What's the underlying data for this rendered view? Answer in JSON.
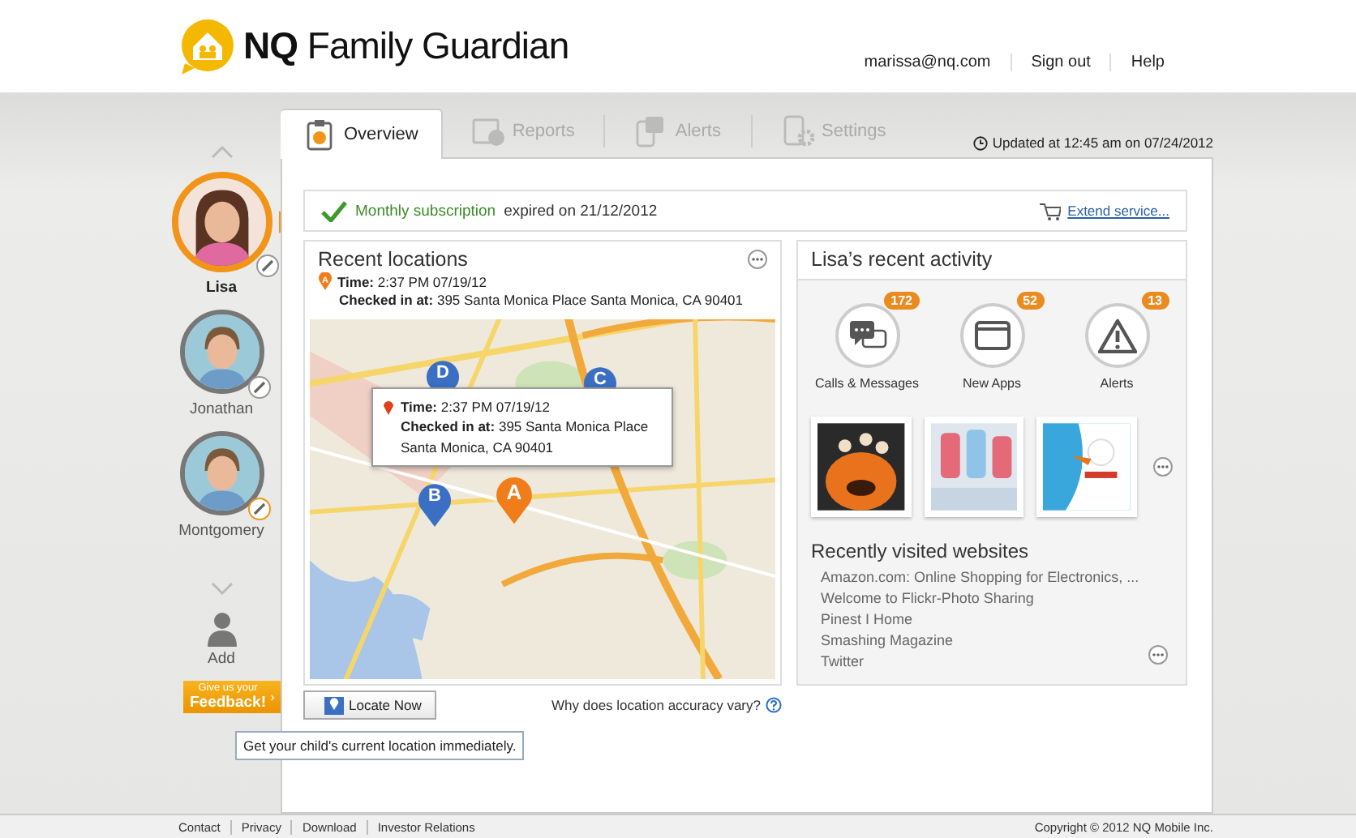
{
  "header": {
    "logo": "**NQ** Family Guardian",
    "user_links": [
      {
        "label": "marissa@nq.com"
      },
      {
        "label": "Sign out"
      },
      {
        "label": "Help"
      }
    ]
  },
  "children": [
    {
      "name": "Lisa",
      "selected": true,
      "kind": "girl"
    },
    {
      "name": "Jonathan",
      "selected": false,
      "kind": "boy"
    },
    {
      "name": "Montgomery",
      "selected": false,
      "kind": "boy"
    }
  ],
  "add_label": "Add",
  "feedback": {
    "line1": "Give us your",
    "line2": "Feedback!"
  },
  "tabs": [
    {
      "label": "Overview",
      "selected": true,
      "kind": "overview"
    },
    {
      "label": "Reports",
      "selected": false,
      "kind": "reports"
    },
    {
      "label": "Alerts",
      "selected": false,
      "kind": "alerts"
    },
    {
      "label": "Settings",
      "selected": false,
      "kind": "settings"
    }
  ],
  "updated": "Updated at 12:45 am on 07/24/2012",
  "subscription": {
    "plan": "Monthly subscription",
    "status": "expired on 21/12/2012",
    "link": "Extend service..."
  },
  "recent_locations": {
    "title": "Recent locations",
    "marker": "A",
    "time": "**Time:** 2:37 PM 07/19/12",
    "checked_in": "**Checked in at:** 395 Santa Monica Place Santa Monica, CA 90401",
    "popup": {
      "time": "**Time:** 2:37 PM 07/19/12",
      "checked_in": "**Checked in at:** 395 Santa Monica Place",
      "address": "Santa Monica, CA 90401"
    },
    "pins": [
      {
        "label": "D",
        "color": "#3a6fc4",
        "kind": "past"
      },
      {
        "label": "C",
        "color": "#3a6fc4",
        "kind": "past"
      },
      {
        "label": "B",
        "color": "#3a6fc4",
        "kind": "past"
      },
      {
        "label": "A",
        "color": "#f07c1a",
        "kind": "current"
      }
    ]
  },
  "locate_button": "Locate Now",
  "tooltip": "Get your child's current location immediately.",
  "accuracy_link": "Why does location accuracy vary?",
  "activity": {
    "title": "Lisa’s recent activity",
    "stats": [
      {
        "label": "Calls & Messages",
        "count": "172",
        "kind": "messages"
      },
      {
        "label": "New Apps",
        "count": "52",
        "kind": "apps"
      },
      {
        "label": "Alerts",
        "count": "13",
        "kind": "alerts"
      }
    ],
    "websites_title": "Recently visited websites",
    "websites": [
      "Amazon.com: Online Shopping for Electronics, ...",
      "Welcome to Flickr-Photo Sharing",
      "Pinest I Home",
      "Smashing Magazine",
      "Twitter"
    ]
  },
  "footer": {
    "links": [
      "Contact",
      "Privacy",
      "Download",
      "Investor Relations"
    ],
    "copyright": "Copyright © 2012 NQ Mobile Inc."
  }
}
